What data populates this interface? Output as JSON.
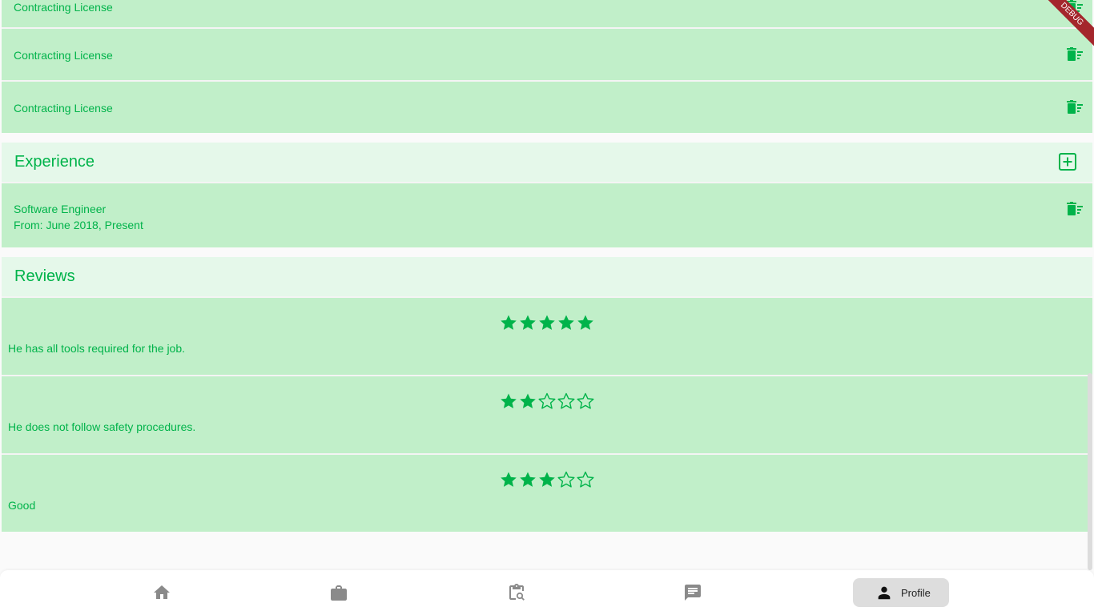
{
  "licenses": [
    {
      "label": "Contracting License"
    },
    {
      "label": "Contracting License"
    },
    {
      "label": "Contracting License"
    }
  ],
  "experience": {
    "title": "Experience",
    "items": [
      {
        "job": "Software Engineer",
        "dates": "From: June 2018, Present"
      }
    ]
  },
  "reviews": {
    "title": "Reviews",
    "items": [
      {
        "rating": 5,
        "text": "He has all tools required for the job."
      },
      {
        "rating": 2,
        "text": "He does not follow safety procedures."
      },
      {
        "rating": 3,
        "text": "Good"
      }
    ]
  },
  "debug_banner": "DEBUG",
  "nav": {
    "items": [
      {
        "icon": "home-icon"
      },
      {
        "icon": "briefcase-icon"
      },
      {
        "icon": "clipboard-search-icon"
      },
      {
        "icon": "chat-icon"
      },
      {
        "icon": "person-icon",
        "label": "Profile"
      }
    ],
    "active": "Profile"
  },
  "colors": {
    "accent": "#00b34a",
    "row_bg": "#c1efc9",
    "header_bg": "#e5f8ea",
    "nav_inactive": "#8a8a8a",
    "nav_active_bg": "#dddddd"
  }
}
